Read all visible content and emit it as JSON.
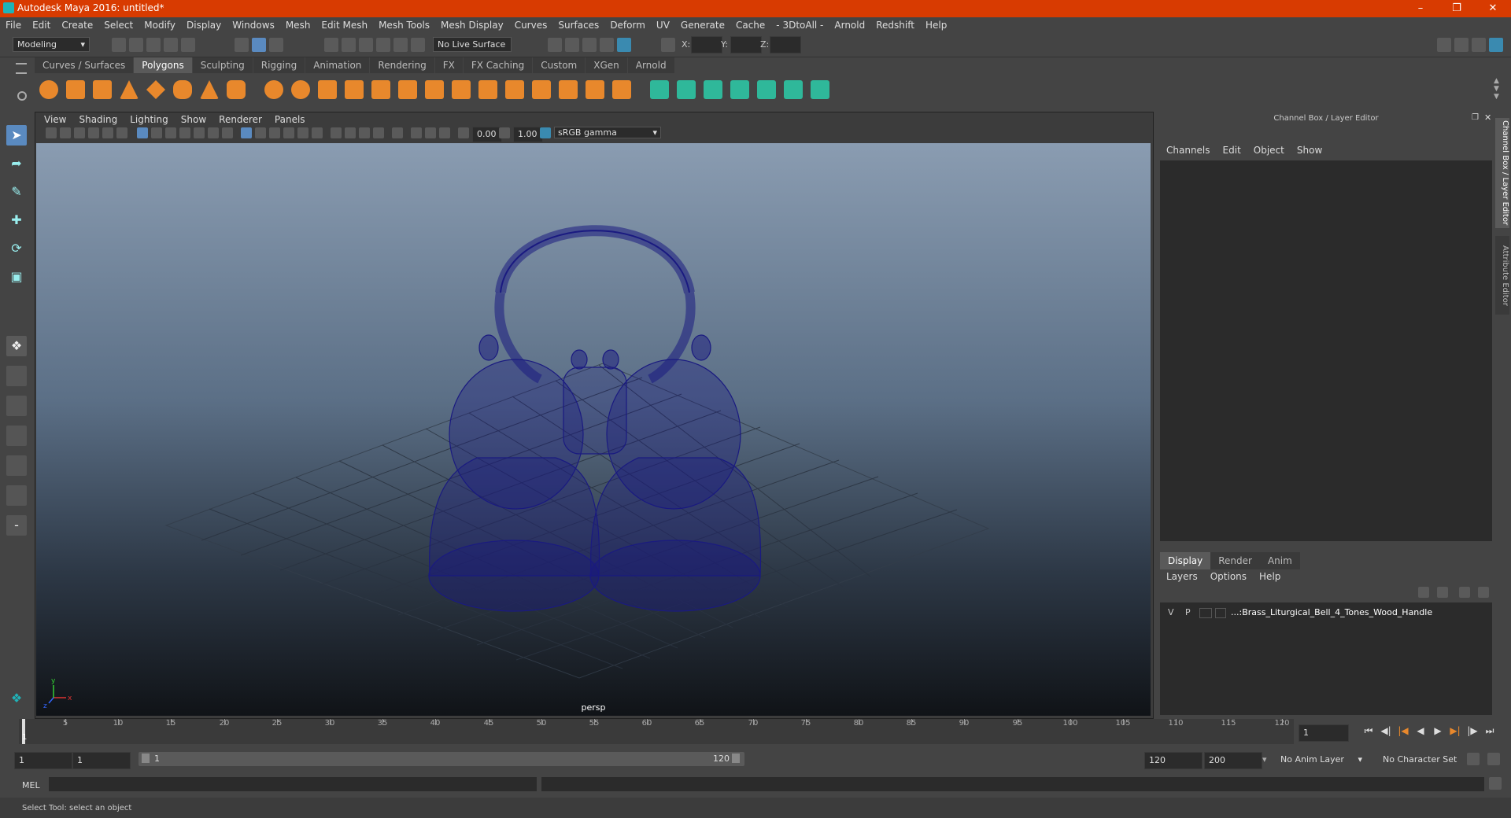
{
  "window": {
    "title": "Autodesk Maya 2016: untitled*"
  },
  "menubar": [
    "File",
    "Edit",
    "Create",
    "Select",
    "Modify",
    "Display",
    "Windows",
    "Mesh",
    "Edit Mesh",
    "Mesh Tools",
    "Mesh Display",
    "Curves",
    "Surfaces",
    "Deform",
    "UV",
    "Generate",
    "Cache",
    "- 3DtoAll -",
    "Arnold",
    "Redshift",
    "Help"
  ],
  "status": {
    "mode": "Modeling",
    "live_surface": "No Live Surface",
    "x_label": "X:",
    "y_label": "Y:",
    "z_label": "Z:"
  },
  "shelf": {
    "tabs": [
      "Curves / Surfaces",
      "Polygons",
      "Sculpting",
      "Rigging",
      "Animation",
      "Rendering",
      "FX",
      "FX Caching",
      "Custom",
      "XGen",
      "Arnold"
    ],
    "active_tab": "Polygons",
    "icon_color_orange": "#e8882c",
    "icon_color_green": "#2fb89a"
  },
  "viewport": {
    "menu": [
      "View",
      "Shading",
      "Lighting",
      "Show",
      "Renderer",
      "Panels"
    ],
    "exposure": "0.00",
    "gamma": "1.00",
    "color_space": "sRGB gamma",
    "camera_label": "persp",
    "wire_color": "#1a1a80",
    "axis_x": "x",
    "axis_y": "y",
    "axis_z": "z"
  },
  "channel_box": {
    "title": "Channel Box / Layer Editor",
    "menu": [
      "Channels",
      "Edit",
      "Object",
      "Show"
    ],
    "side_tab_1": "Channel Box / Layer Editor",
    "side_tab_2": "Attribute Editor"
  },
  "layer_editor": {
    "tabs": [
      "Display",
      "Render",
      "Anim"
    ],
    "active_tab": "Display",
    "menu": [
      "Layers",
      "Options",
      "Help"
    ],
    "layer": {
      "v": "V",
      "p": "P",
      "name": "...:Brass_Liturgical_Bell_4_Tones_Wood_Handle"
    }
  },
  "timeline": {
    "ticks": [
      "5",
      "10",
      "15",
      "20",
      "25",
      "30",
      "35",
      "40",
      "45",
      "50",
      "55",
      "60",
      "65",
      "70",
      "75",
      "80",
      "85",
      "90",
      "95",
      "100",
      "105",
      "110",
      "115",
      "120"
    ],
    "current_frame_marker": "1",
    "current_frame": "1"
  },
  "range": {
    "start": "1",
    "playback_start": "1",
    "slider_start": "1",
    "slider_end": "120",
    "playback_end": "120",
    "end": "200",
    "anim_layer": "No Anim Layer",
    "character_set": "No Character Set"
  },
  "cmdline": {
    "label": "MEL"
  },
  "helpline": {
    "text": "Select Tool: select an object"
  }
}
